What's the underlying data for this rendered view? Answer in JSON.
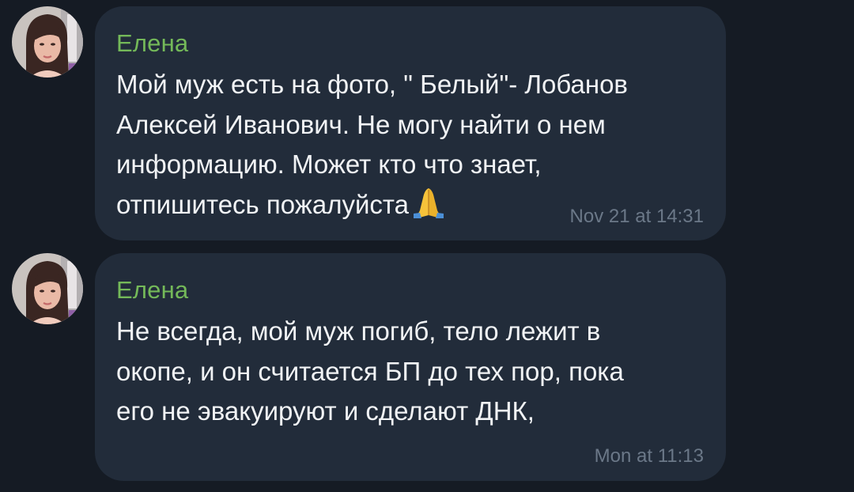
{
  "messages": [
    {
      "sender": "Елена",
      "text": "Мой муж есть на фото, \" Белый\"- Лобанов\nАлексей Иванович. Не могу найти о нем\nинформацию. Может кто что знает,\nотпишитесь пожалуйста",
      "emoji": "folded-hands-emoji",
      "time": "Nov 21 at 14:31"
    },
    {
      "sender": "Елена",
      "text": "Не всегда, мой муж погиб, тело лежит в\nокопе, и он считается БП до тех пор, пока\nего не эвакуируют и сделают ДНК,",
      "time": "Mon at 11:13"
    }
  ],
  "colors": {
    "background": "#151b24",
    "bubble": "#222c3a",
    "sender_name": "#74b959",
    "message_text": "#f1f3f5",
    "timestamp": "#6b7888"
  }
}
